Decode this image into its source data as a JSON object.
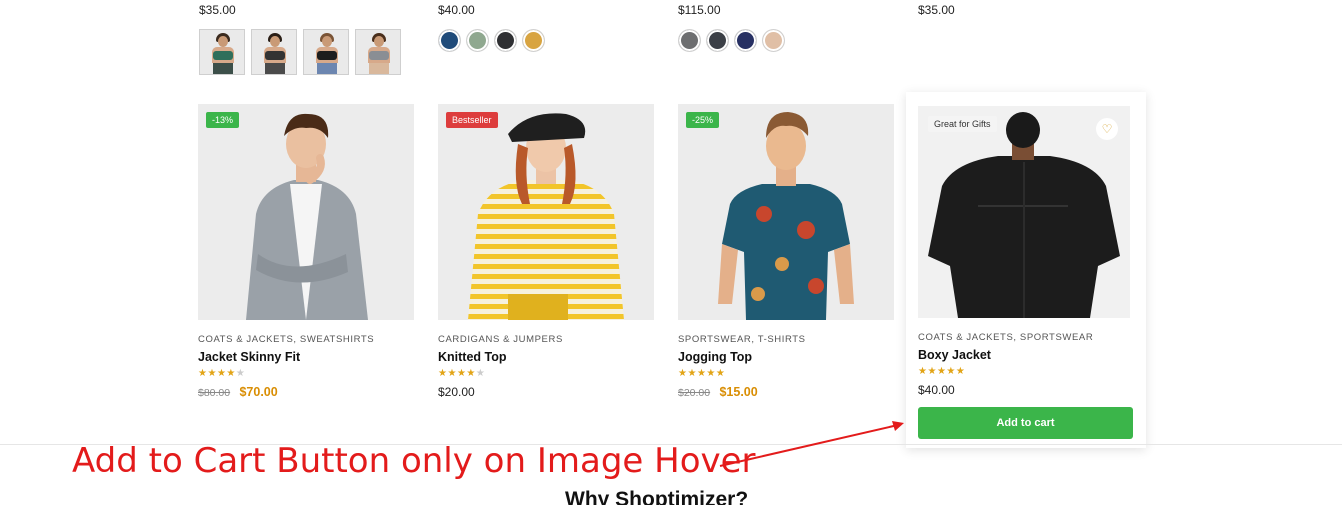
{
  "top_row": {
    "prices": [
      "$35.00",
      "$40.00",
      "$115.00",
      "$35.00"
    ],
    "thumbnails": [
      {
        "name": "green-sports-bra",
        "top_color": "#2f6f5b",
        "leg_color": "#3c4f49",
        "hair_color": "#3a2a1e"
      },
      {
        "name": "dark-sports-bra",
        "top_color": "#333333",
        "leg_color": "#4a4a4a",
        "hair_color": "#2a1e16"
      },
      {
        "name": "black-sports-bra",
        "top_color": "#1d1d1d",
        "leg_color": "#6c86b0",
        "hair_color": "#7a5436"
      },
      {
        "name": "grey-sports-bra",
        "top_color": "#8a8e94",
        "leg_color": "#d9b89c",
        "hair_color": "#4a2f1c"
      }
    ],
    "swatches_a": [
      "#1f4b7a",
      "#8fa88f",
      "#2f3033",
      "#d8a441"
    ],
    "swatches_b": [
      "#6d6e70",
      "#3b3f46",
      "#273063",
      "#e0bfa6"
    ]
  },
  "products": [
    {
      "badge": "-13%",
      "categories": [
        "COATS & JACKETS",
        "SWEATSHIRTS"
      ],
      "title": "Jacket Skinny Fit",
      "rating": 4,
      "old_price": "$80.00",
      "price": "$70.00"
    },
    {
      "badge": "Bestseller",
      "categories": [
        "CARDIGANS & JUMPERS"
      ],
      "title": "Knitted Top",
      "rating": 4,
      "price": "$20.00"
    },
    {
      "badge": "-25%",
      "categories": [
        "SPORTSWEAR",
        "T-SHIRTS"
      ],
      "title": "Jogging Top",
      "rating": 5,
      "old_price": "$20.00",
      "price": "$15.00"
    },
    {
      "badge": "Great for Gifts",
      "categories": [
        "COATS & JACKETS",
        "SPORTSWEAR"
      ],
      "title": "Boxy Jacket",
      "rating": 5,
      "price": "$40.00",
      "add_to_cart_label": "Add to cart",
      "wishlist_icon": "heart-icon"
    }
  ],
  "annotation": {
    "text": "Add to Cart Button only on Image Hover",
    "color": "#e31b1b"
  },
  "next_section": {
    "title": "Why Shoptimizer?"
  },
  "colors": {
    "accent_green": "#3bb54a",
    "sale_price": "#d98e04",
    "star": "#e2a416",
    "badge_red": "#dd3d3d"
  }
}
